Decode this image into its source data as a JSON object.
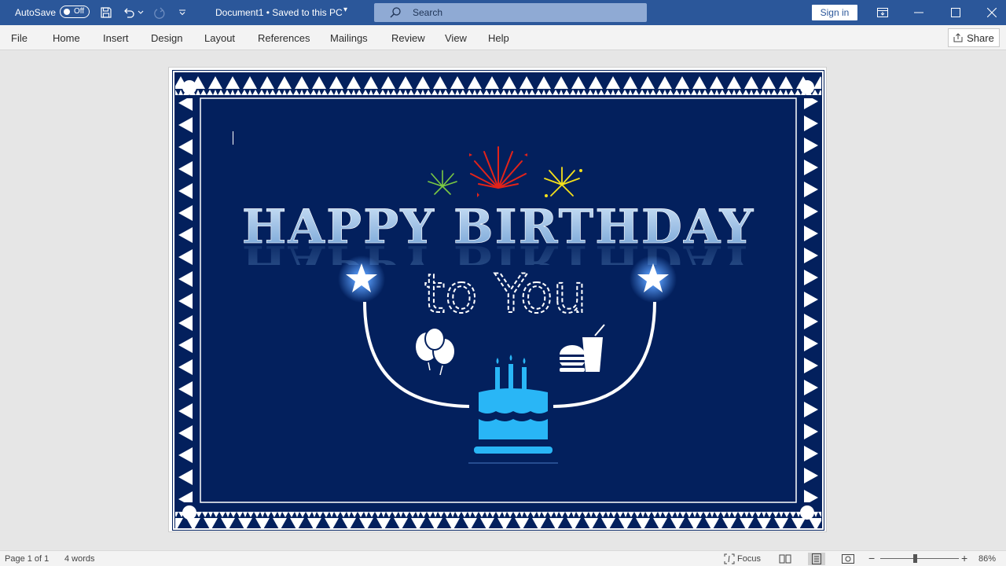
{
  "titlebar": {
    "autosave_label": "AutoSave",
    "autosave_state": "Off",
    "doc_title": "Document1 • Saved to this PC",
    "search_placeholder": "Search",
    "signin_label": "Sign in"
  },
  "ribbon": {
    "tabs": [
      "File",
      "Home",
      "Insert",
      "Design",
      "Layout",
      "References",
      "Mailings",
      "Review",
      "View",
      "Help"
    ],
    "share_label": "Share"
  },
  "document": {
    "headline": "HAPPY BIRTHDAY",
    "subline": "to You"
  },
  "statusbar": {
    "page_info": "Page 1 of 1",
    "word_count": "4 words",
    "focus_label": "Focus",
    "zoom_level": "86%"
  },
  "colors": {
    "title_bar": "#2b579a",
    "card_navy": "#03205d",
    "cake_blue": "#29b6f6"
  }
}
